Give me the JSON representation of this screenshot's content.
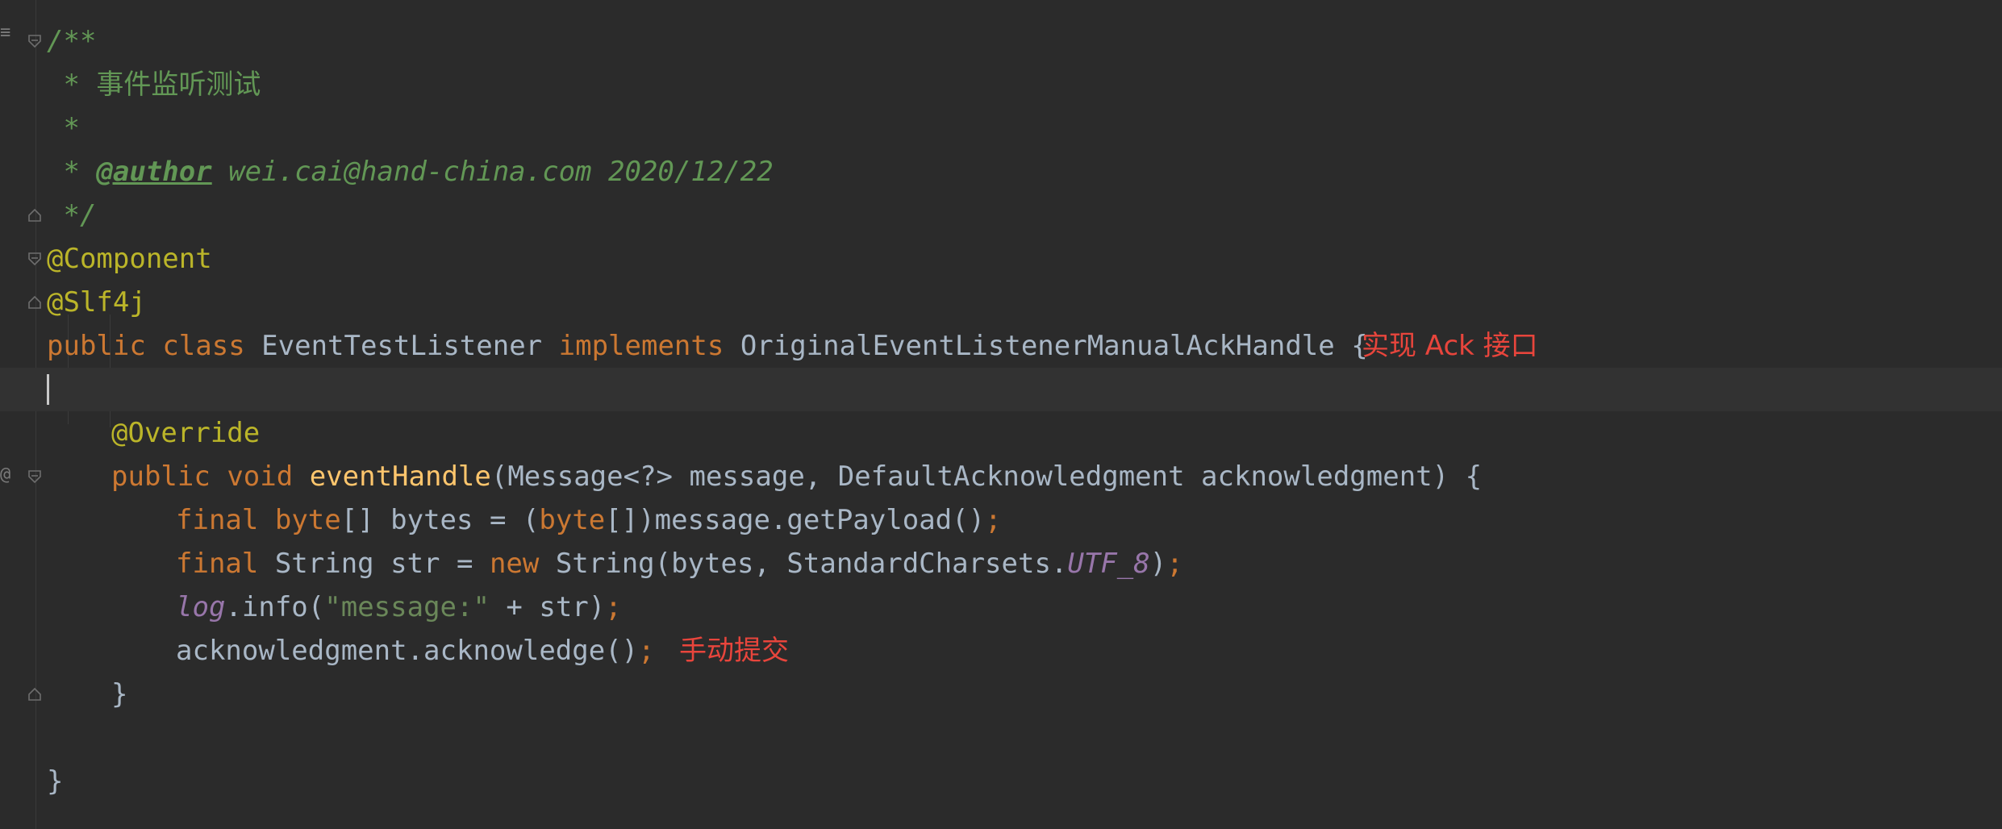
{
  "code": {
    "line1": "/**",
    "line2_star": " * ",
    "line2_text": "事件监听测试",
    "line3": " *",
    "line4_star": " * ",
    "line4_tag": "@author",
    "line4_text": " wei.cai@hand-china.com 2020/12/22",
    "line5": " */",
    "line6": "@Component",
    "line7": "@Slf4j",
    "line8_kw1": "public",
    "line8_kw2": "class",
    "line8_name": "EventTestListener",
    "line8_kw3": "implements",
    "line8_iface": "OriginalEventListenerManualAckHandle {",
    "line10": "@Override",
    "line11_kw1": "public",
    "line11_kw2": "void",
    "line11_fn": "eventHandle",
    "line11_rest": "(Message<?> message, DefaultAcknowledgment acknowledgment) {",
    "line12_kw1": "final",
    "line12_kw2": "byte",
    "line12_mid": "[] bytes = (",
    "line12_kw3": "byte",
    "line12_rest": "[])message.getPayload()",
    "line13_kw1": "final",
    "line13_mid": " String str = ",
    "line13_kw2": "new",
    "line13_mid2": " String(bytes, StandardCharsets.",
    "line13_const": "UTF_8",
    "line13_end": ")",
    "line14_log": "log",
    "line14_mid": ".info(",
    "line14_str": "\"message:\"",
    "line14_end": " + str)",
    "line15": "acknowledgment.acknowledge()",
    "line16": "}",
    "line18": "}",
    "semicolon": ";",
    "comma": ","
  },
  "annotations": {
    "implement_note": "实现 Ack 接口",
    "manual_commit_note": "手动提交"
  },
  "colors": {
    "background": "#2b2b2b",
    "keyword": "#cc7832",
    "doc_comment": "#629755",
    "annotation": "#bbb529",
    "note_red": "#e8453c"
  }
}
